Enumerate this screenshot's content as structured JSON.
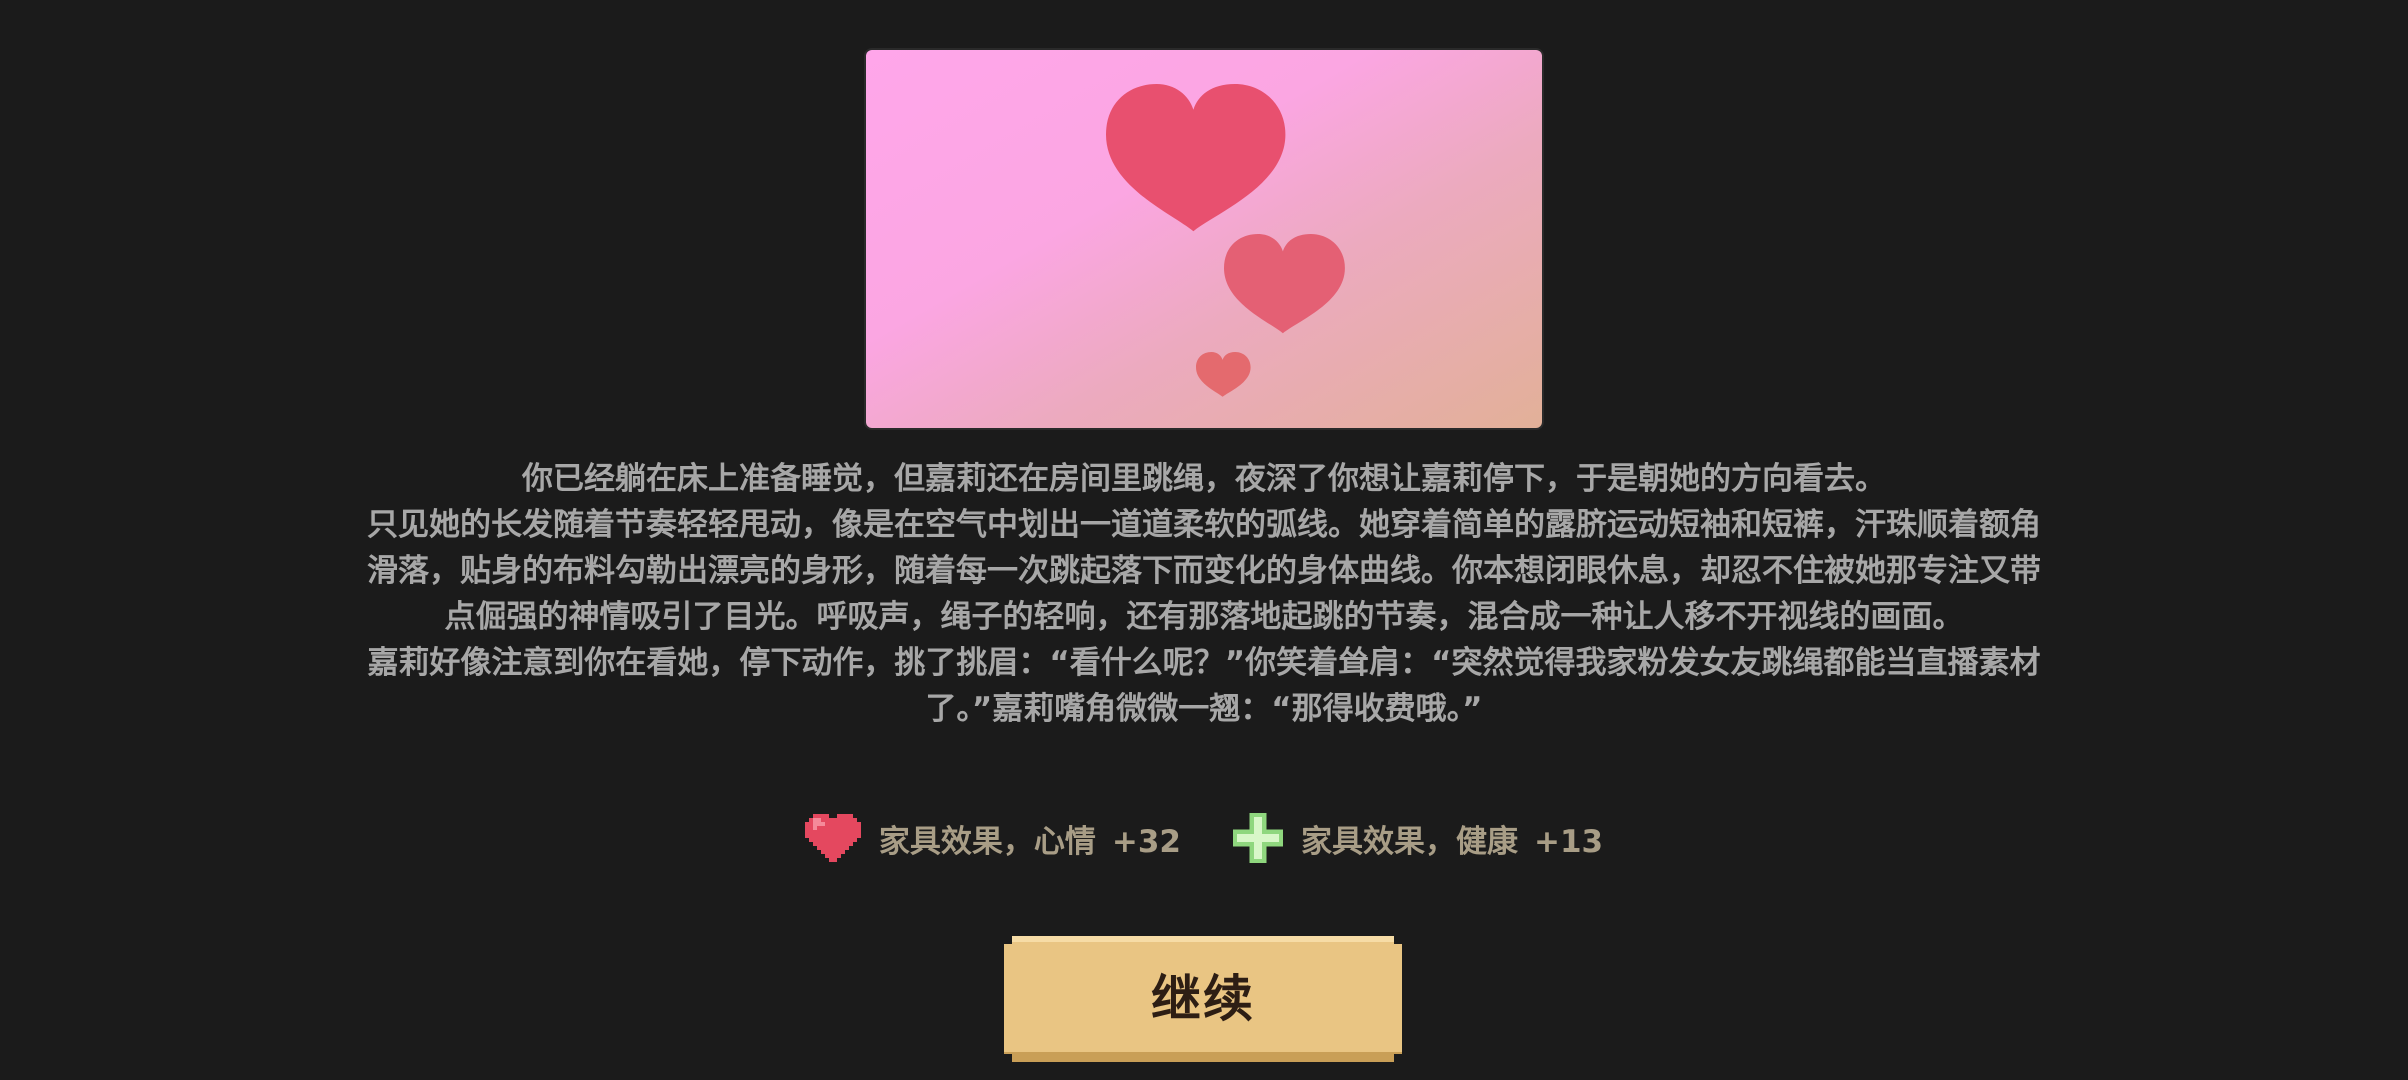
{
  "story": {
    "paragraphs": [
      "你已经躺在床上准备睡觉，但嘉莉还在房间里跳绳，夜深了你想让嘉莉停下，于是朝她的方向看去。",
      "只见她的长发随着节奏轻轻甩动，像是在空气中划出一道道柔软的弧线。她穿着简单的露脐运动短袖和短裤，汗珠顺着额角滑落，贴身的布料勾勒出漂亮的身形，随着每一次跳起落下而变化的身体曲线。你本想闭眼休息，却忍不住被她那专注又带点倔强的神情吸引了目光。呼吸声，绳子的轻响，还有那落地起跳的节奏，混合成一种让人移不开视线的画面。",
      "嘉莉好像注意到你在看她，停下动作，挑了挑眉：“看什么呢？”你笑着耸肩：“突然觉得我家粉发女友跳绳都能当直播素材了。”嘉莉嘴角微微一翘：“那得收费哦。”"
    ]
  },
  "scene": {
    "icon": "floating-hearts-icon",
    "gradient_colors": [
      "#ffa6ea",
      "#e2b098"
    ],
    "heart_colors": [
      "#e8506f",
      "#e46074",
      "#e46a6e"
    ]
  },
  "effects": [
    {
      "icon": "heart-icon",
      "label": "家具效果，心情",
      "value": "+32",
      "icon_color": "#e4485f"
    },
    {
      "icon": "health-cross-icon",
      "label": "家具效果，健康",
      "value": "+13",
      "icon_color": "#8fd77e"
    }
  ],
  "colors": {
    "background": "#1b1b1b",
    "story_text": "#a7a7a7",
    "effect_text": "#a89d86",
    "button_fill": "#e9c583",
    "button_text": "#2d1e14"
  },
  "continue_button": {
    "label": "继续"
  }
}
